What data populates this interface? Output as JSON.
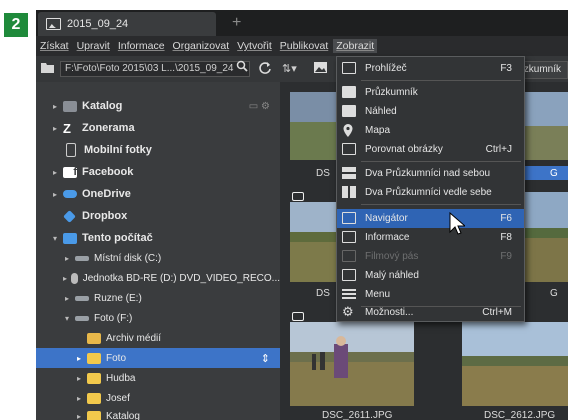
{
  "step_badge": "2",
  "tab": {
    "title": "2015_09_24",
    "new_tab": "+"
  },
  "menubar": [
    "Získat",
    "Upravit",
    "Informace",
    "Organizovat",
    "Vytvořit",
    "Publikovat",
    "Zobrazit"
  ],
  "toolbar": {
    "path": "F:\\Foto\\Foto 2015\\03 L...\\2015_09_24",
    "zoom_icon": "magnifier-icon",
    "refresh_icon": "refresh-icon",
    "sort_icon": "sort-icon",
    "right_label": "růzkumník"
  },
  "sidebar": {
    "items": [
      {
        "label": "Katalog",
        "icon": "catalog-icon",
        "color": "#8a8f96",
        "arrow": "▸",
        "bold": true
      },
      {
        "label": "Zonerama",
        "icon": "zonerama-icon",
        "color": "#ffffff",
        "arrow": "▸",
        "bold": true
      },
      {
        "label": "Mobilní fotky",
        "icon": "phone-icon",
        "color": "#cccccc",
        "arrow": "",
        "bold": true
      },
      {
        "label": "Facebook",
        "icon": "facebook-icon",
        "color": "#ffffff",
        "arrow": "▸",
        "bold": true
      },
      {
        "label": "OneDrive",
        "icon": "onedrive-icon",
        "color": "#4a9ae8",
        "arrow": "▸",
        "bold": true
      },
      {
        "label": "Dropbox",
        "icon": "dropbox-icon",
        "color": "#4a9ae8",
        "arrow": "",
        "bold": true
      },
      {
        "label": "Tento počítač",
        "icon": "computer-icon",
        "color": "#4a9ae8",
        "arrow": "▾",
        "bold": true
      },
      {
        "label": "Místní disk (C:)",
        "icon": "drive-icon",
        "color": "#9aa0a6",
        "arrow": "▸",
        "bold": false
      },
      {
        "label": "Jednotka BD-RE (D:) DVD_VIDEO_RECO...",
        "icon": "disc-icon",
        "color": "#bbbbbb",
        "arrow": "▸",
        "bold": false
      },
      {
        "label": "Ruzne (E:)",
        "icon": "drive-icon",
        "color": "#9aa0a6",
        "arrow": "▸",
        "bold": false
      },
      {
        "label": "Foto (F:)",
        "icon": "drive-icon",
        "color": "#9aa0a6",
        "arrow": "▾",
        "bold": false
      },
      {
        "label": "Archiv médií",
        "icon": "folder-icon",
        "color": "#e8b84a",
        "arrow": "",
        "bold": false
      },
      {
        "label": "Foto",
        "icon": "folder-icon",
        "color": "#f2c94c",
        "arrow": "▸",
        "bold": false,
        "selected": true,
        "right": "⇕"
      },
      {
        "label": "Hudba",
        "icon": "folder-icon",
        "color": "#f2c94c",
        "arrow": "▸",
        "bold": false
      },
      {
        "label": "Josef",
        "icon": "folder-icon",
        "color": "#f2c94c",
        "arrow": "▸",
        "bold": false
      },
      {
        "label": "Katalog",
        "icon": "folder-icon",
        "color": "#f2c94c",
        "arrow": "▸",
        "bold": false
      }
    ]
  },
  "thumbnails": {
    "captions": [
      "DSC_2611.JPG",
      "DSC_2612.JPG"
    ],
    "partial_left": "DS",
    "partial_right": "G"
  },
  "menu": {
    "items": [
      {
        "label": "Prohlížeč",
        "shortcut": "F3",
        "icon": "viewer-icon"
      },
      {
        "label": "Průzkumník",
        "shortcut": "",
        "icon": "explorer-icon"
      },
      {
        "label": "Náhled",
        "shortcut": "",
        "icon": "preview-icon"
      },
      {
        "label": "Mapa",
        "shortcut": "",
        "icon": "map-pin-icon"
      },
      {
        "label": "Porovnat obrázky",
        "shortcut": "Ctrl+J",
        "icon": "compare-icon"
      },
      {
        "label": "Dva Průzkumníci nad sebou",
        "shortcut": "",
        "icon": "split-horizontal-icon"
      },
      {
        "label": "Dva Průzkumníci vedle sebe",
        "shortcut": "",
        "icon": "split-vertical-icon"
      },
      {
        "label": "Navigátor",
        "shortcut": "F6",
        "icon": "navigator-icon",
        "highlight": true
      },
      {
        "label": "Informace",
        "shortcut": "F8",
        "icon": "info-panel-icon"
      },
      {
        "label": "Filmový pás",
        "shortcut": "F9",
        "icon": "filmstrip-icon",
        "disabled": true
      },
      {
        "label": "Malý náhled",
        "shortcut": "",
        "icon": "small-preview-icon"
      },
      {
        "label": "Menu",
        "shortcut": "",
        "icon": "menu-icon"
      },
      {
        "label": "Možnosti...",
        "shortcut": "Ctrl+M",
        "icon": "settings-icon"
      }
    ]
  }
}
